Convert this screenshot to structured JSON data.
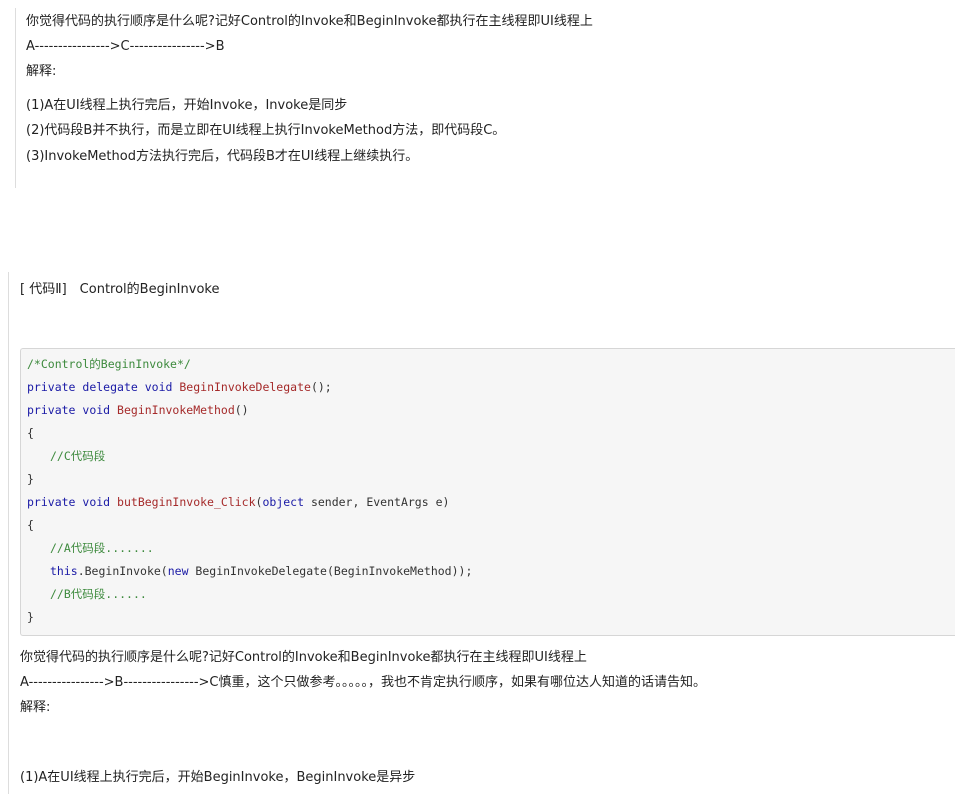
{
  "top_block": {
    "question": "你觉得代码的执行顺序是什么呢?记好Control的Invoke和BeginInvoke都执行在主线程即UI线程上",
    "sequence": "A---------------->C---------------->B",
    "explain_label": "解释:",
    "points": [
      "(1)A在UI线程上执行完后，开始Invoke，Invoke是同步",
      "(2)代码段B并不执行，而是立即在UI线程上执行InvokeMethod方法，即代码段C。",
      "(3)InvokeMethod方法执行完后，代码段B才在UI线程上继续执行。"
    ]
  },
  "second_block": {
    "heading": "[ 代码Ⅱ]　Control的BeginInvoke",
    "code": {
      "line1_comment": "/*Control的BeginInvoke*/",
      "line2_kw1": "private",
      "line2_kw2": "delegate",
      "line2_kw3": "void",
      "line2_fn": "BeginInvokeDelegate",
      "line2_rest": "();",
      "line3_kw1": "private",
      "line3_kw2": "void",
      "line3_fn": "BeginInvokeMethod",
      "line3_rest": "()",
      "line4": "{",
      "line5_comment": "//C代码段",
      "line6": "}",
      "line7_kw1": "private",
      "line7_kw2": "void",
      "line7_fn": "butBeginInvoke_Click",
      "line7_p1": "(",
      "line7_kw3": "object",
      "line7_rest": " sender, EventArgs e)",
      "line8": "{",
      "line9_comment": "//A代码段.......",
      "line10_kw1": "this",
      "line10_p1": ".BeginInvoke(",
      "line10_kw2": "new",
      "line10_rest": " BeginInvokeDelegate(BeginInvokeMethod));",
      "line11_comment": "//B代码段......",
      "line12": "}"
    },
    "question": "你觉得代码的执行顺序是什么呢?记好Control的Invoke和BeginInvoke都执行在主线程即UI线程上",
    "sequence": "A---------------->B---------------->C慎重，这个只做参考。。。。。，我也不肯定执行顺序，如果有哪位达人知道的话请告知。",
    "explain_label": "解释:",
    "point1": "(1)A在UI线程上执行完后，开始BeginInvoke，BeginInvoke是异步"
  }
}
